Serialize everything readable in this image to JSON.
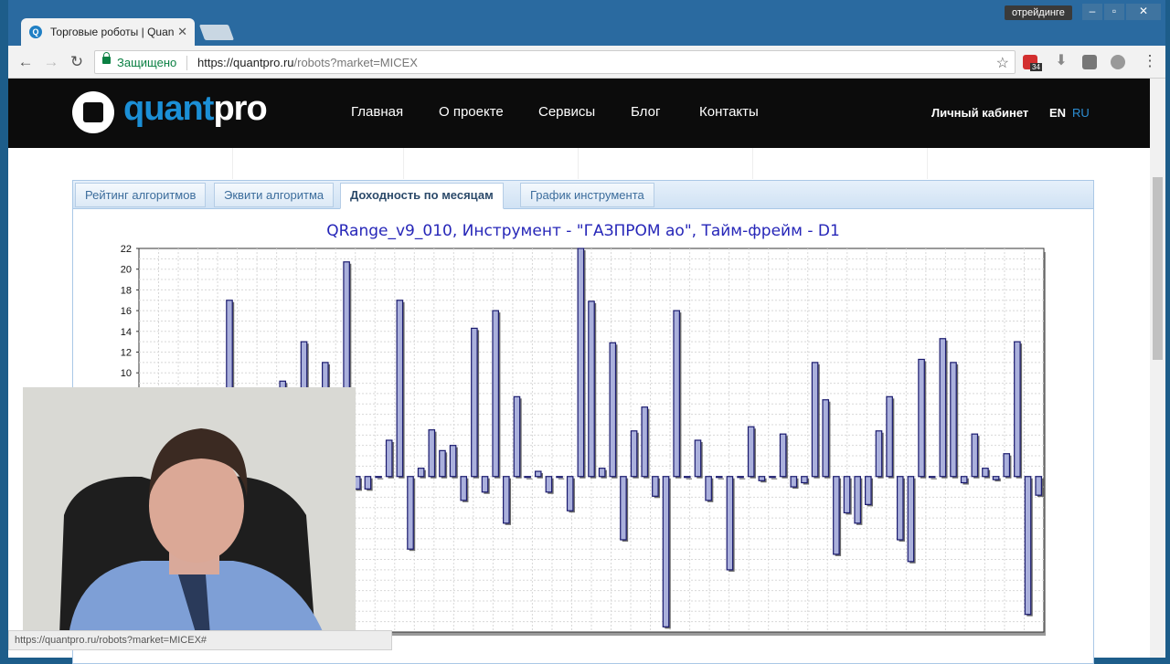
{
  "browser": {
    "tab_title": "Торговые роботы | Quan",
    "profile": "отрейдинге",
    "secure_label": "Защищено",
    "url_host": "https://quantpro.ru",
    "url_rest": "/robots?market=MICEX",
    "extension_badge": "34",
    "status_url": "https://quantpro.ru/robots?market=MICEX#"
  },
  "site": {
    "logo_q": "quant",
    "logo_p": "pro",
    "nav": [
      "Главная",
      "О проекте",
      "Сервисы",
      "Блог",
      "Контакты"
    ],
    "cabinet": "Личный кабинет",
    "lang_en": "EN",
    "lang_ru": "RU"
  },
  "panel_tabs": [
    "Рейтинг алгоритмов",
    "Эквити алгоритма",
    "Доходность по месяцам",
    "График инструмента"
  ],
  "active_tab": 2,
  "colors": {
    "bar_fill": "#aab0dc",
    "bar_stroke": "#1a1a6e",
    "title": "#2626b8",
    "logo_blue": "#1b8fd6"
  },
  "chart_data": {
    "type": "bar",
    "title": "QRange_v9_010, Инструмент - \"ГАЗПРОМ ао\", Тайм-фрейм - D1",
    "ylim": [
      -15,
      22
    ],
    "y_ticks": [
      22,
      20,
      18,
      16,
      14,
      12,
      10
    ],
    "grid": true,
    "values": [
      0,
      0,
      0,
      0,
      0,
      0,
      0,
      0,
      17,
      0,
      0,
      0,
      0,
      9.2,
      0,
      13,
      0,
      11,
      0,
      20.7,
      -1.2,
      -1.2,
      0,
      3.5,
      17,
      -7,
      0.8,
      4.5,
      2.5,
      3,
      -2.3,
      14.3,
      -1.5,
      16,
      -4.5,
      7.7,
      0,
      0.5,
      -1.5,
      0,
      -3.3,
      22,
      16.9,
      0.8,
      12.9,
      -6.1,
      4.4,
      6.7,
      -1.9,
      -14.5,
      16,
      0,
      3.5,
      -2.3,
      0,
      -9,
      0,
      4.8,
      -0.4,
      0,
      4.1,
      -1,
      -0.6,
      11,
      7.4,
      -7.5,
      -3.5,
      -4.5,
      -2.7,
      4.4,
      7.7,
      -6.1,
      -8.2,
      11.3,
      0,
      13.3,
      11,
      -0.6,
      4.1,
      0.8,
      -0.3,
      2.2,
      13,
      -13.3,
      -1.8
    ]
  }
}
